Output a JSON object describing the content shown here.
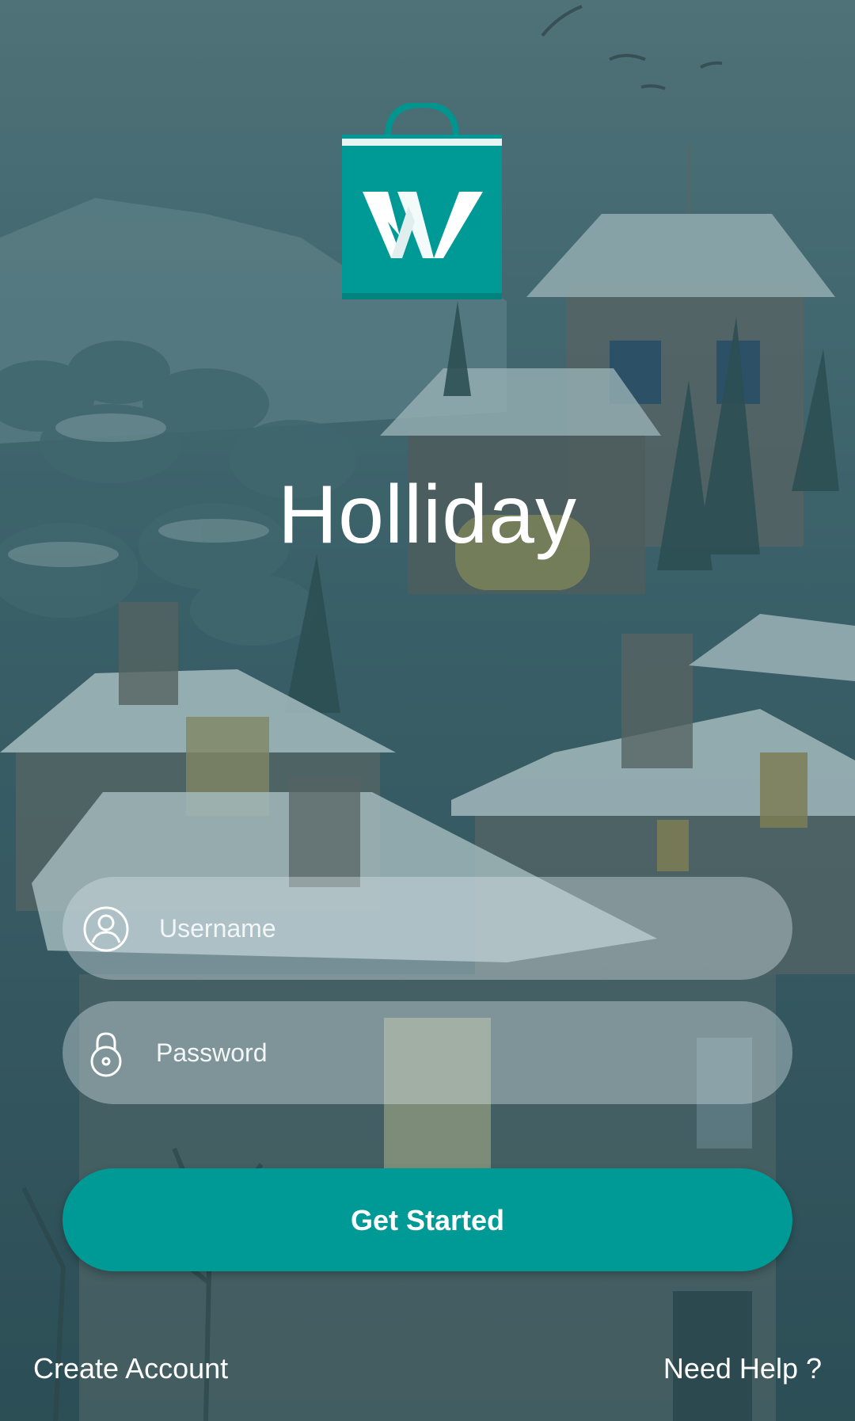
{
  "app": {
    "title": "Holliday",
    "logo_letter": "W"
  },
  "colors": {
    "accent": "#009a96",
    "field_background": "rgba(215,228,232,0.40)",
    "text": "#ffffff"
  },
  "form": {
    "username": {
      "placeholder": "Username",
      "value": "",
      "icon": "user-circle-icon"
    },
    "password": {
      "placeholder": "Password",
      "value": "",
      "icon": "lock-icon"
    },
    "submit_label": "Get Started"
  },
  "footer": {
    "create_account_label": "Create Account",
    "need_help_label": "Need Help ?"
  }
}
